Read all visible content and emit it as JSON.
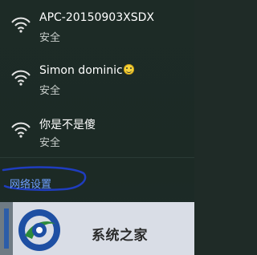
{
  "networks": [
    {
      "name": "APC-20150903XSDX",
      "status": "安全"
    },
    {
      "name": "Simon dominic",
      "status": "安全",
      "emoji": "smiling-emoji"
    },
    {
      "name": "你是不是傻",
      "status": "安全"
    }
  ],
  "settings_link": "网络设置",
  "watermark": {
    "text": "系统之家",
    "icon": "system-home-logo"
  },
  "colors": {
    "link": "#6ea0ff",
    "background": "#1d2b26",
    "highlight_circle": "#1f3dbf"
  }
}
